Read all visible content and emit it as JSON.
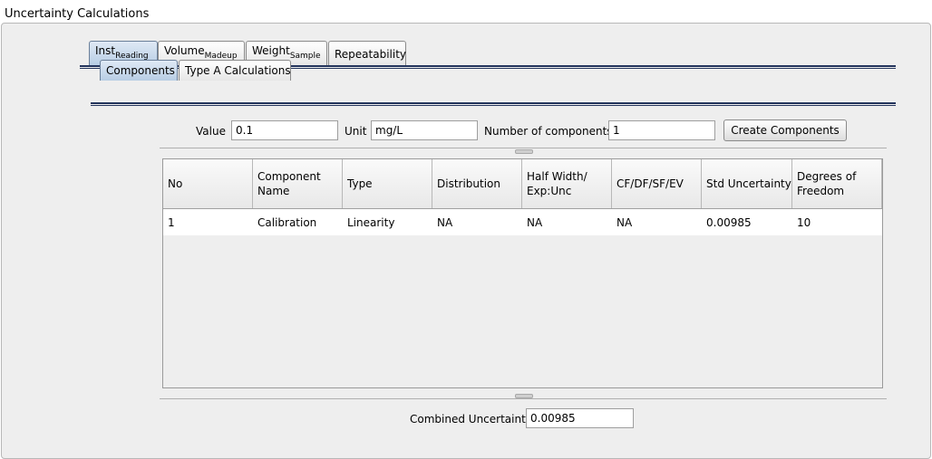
{
  "window": {
    "title": "Uncertainty Calculations"
  },
  "tabs": [
    {
      "label": "Inst",
      "sub": "Reading"
    },
    {
      "label": "Volume",
      "sub": "Madeup"
    },
    {
      "label": "Weight",
      "sub": "Sample"
    },
    {
      "label": "Repeatability",
      "sub": ""
    }
  ],
  "subtabs": [
    "Components",
    "Type A Calculations"
  ],
  "form": {
    "value_label": "Value",
    "value": "0.1",
    "unit_label": "Unit",
    "unit": "mg/L",
    "num_components_label": "Number of components",
    "num_components": "1",
    "create_button": "Create Components"
  },
  "table": {
    "headers": [
      "No",
      "Component Name",
      "Type",
      "Distribution",
      "Half Width/ Exp:Unc",
      "CF/DF/SF/EV",
      "Std Uncertainty",
      "Degrees of Freedom"
    ],
    "rows": [
      [
        "1",
        "Calibration",
        "Linearity",
        "NA",
        "NA",
        "NA",
        "0.00985",
        "10"
      ]
    ]
  },
  "combined": {
    "label": "Combined Uncertainty",
    "value": "0.00985"
  }
}
